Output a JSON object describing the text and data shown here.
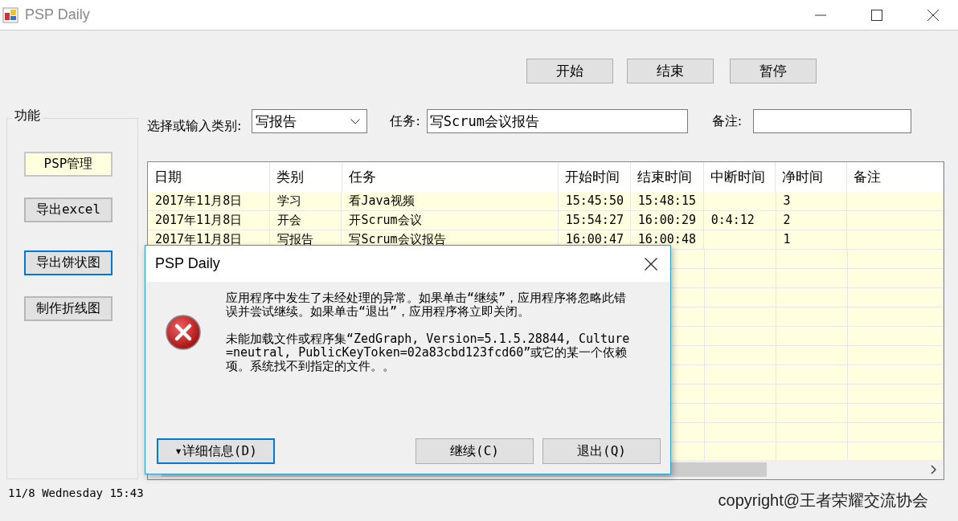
{
  "window": {
    "title": "PSP Daily"
  },
  "toolbar": {
    "buttons": [
      {
        "label": "开始"
      },
      {
        "label": "结束"
      },
      {
        "label": "暂停"
      }
    ]
  },
  "sidebar": {
    "title": "功能",
    "buttons": [
      {
        "label": "PSP管理",
        "selected": true,
        "focused": false
      },
      {
        "label": "导出excel",
        "selected": false,
        "focused": false
      },
      {
        "label": "导出饼状图",
        "selected": false,
        "focused": true
      },
      {
        "label": "制作折线图",
        "selected": false,
        "focused": false
      }
    ]
  },
  "filters": {
    "category_label": "选择或输入类别:",
    "category_value": "写报告",
    "task_label": "任务:",
    "task_value": "写Scrum会议报告",
    "note_label": "备注:"
  },
  "table": {
    "columns": [
      "日期",
      "类别",
      "任务",
      "开始时间",
      "结束时间",
      "中断时间",
      "净时间",
      "备注"
    ],
    "rows": [
      [
        "2017年11月8日",
        "学习",
        "看Java视频",
        "15:45:50",
        "15:48:15",
        "",
        "3",
        ""
      ],
      [
        "2017年11月8日",
        "开会",
        "开Scrum会议",
        "15:54:27",
        "16:00:29",
        "0:4:12",
        "2",
        ""
      ],
      [
        "2017年11月8日",
        "写报告",
        "写Scrum会议报告",
        "16:00:47",
        "16:00:48",
        "",
        "1",
        ""
      ]
    ]
  },
  "status_bar": {
    "datetime": "11/8  Wednesday 15:43",
    "copyright": "copyright@王者荣耀交流协会"
  },
  "dialog": {
    "title": "PSP Daily",
    "message": "应用程序中发生了未经处理的异常。如果单击“继续”，应用程序将忽略此错误并尝试继续。如果单击“退出”，应用程序将立即关闭。",
    "detail": "未能加载文件或程序集“ZedGraph, Version=5.1.5.28844, Culture=neutral, PublicKeyToken=02a83cbd123fcd60”或它的某一个依赖项。系统找不到指定的文件。。",
    "buttons": [
      {
        "label": "▾详细信息(D)",
        "focused": true
      },
      {
        "label": "继续(C)",
        "focused": false
      },
      {
        "label": "退出(Q)",
        "focused": false
      }
    ]
  }
}
